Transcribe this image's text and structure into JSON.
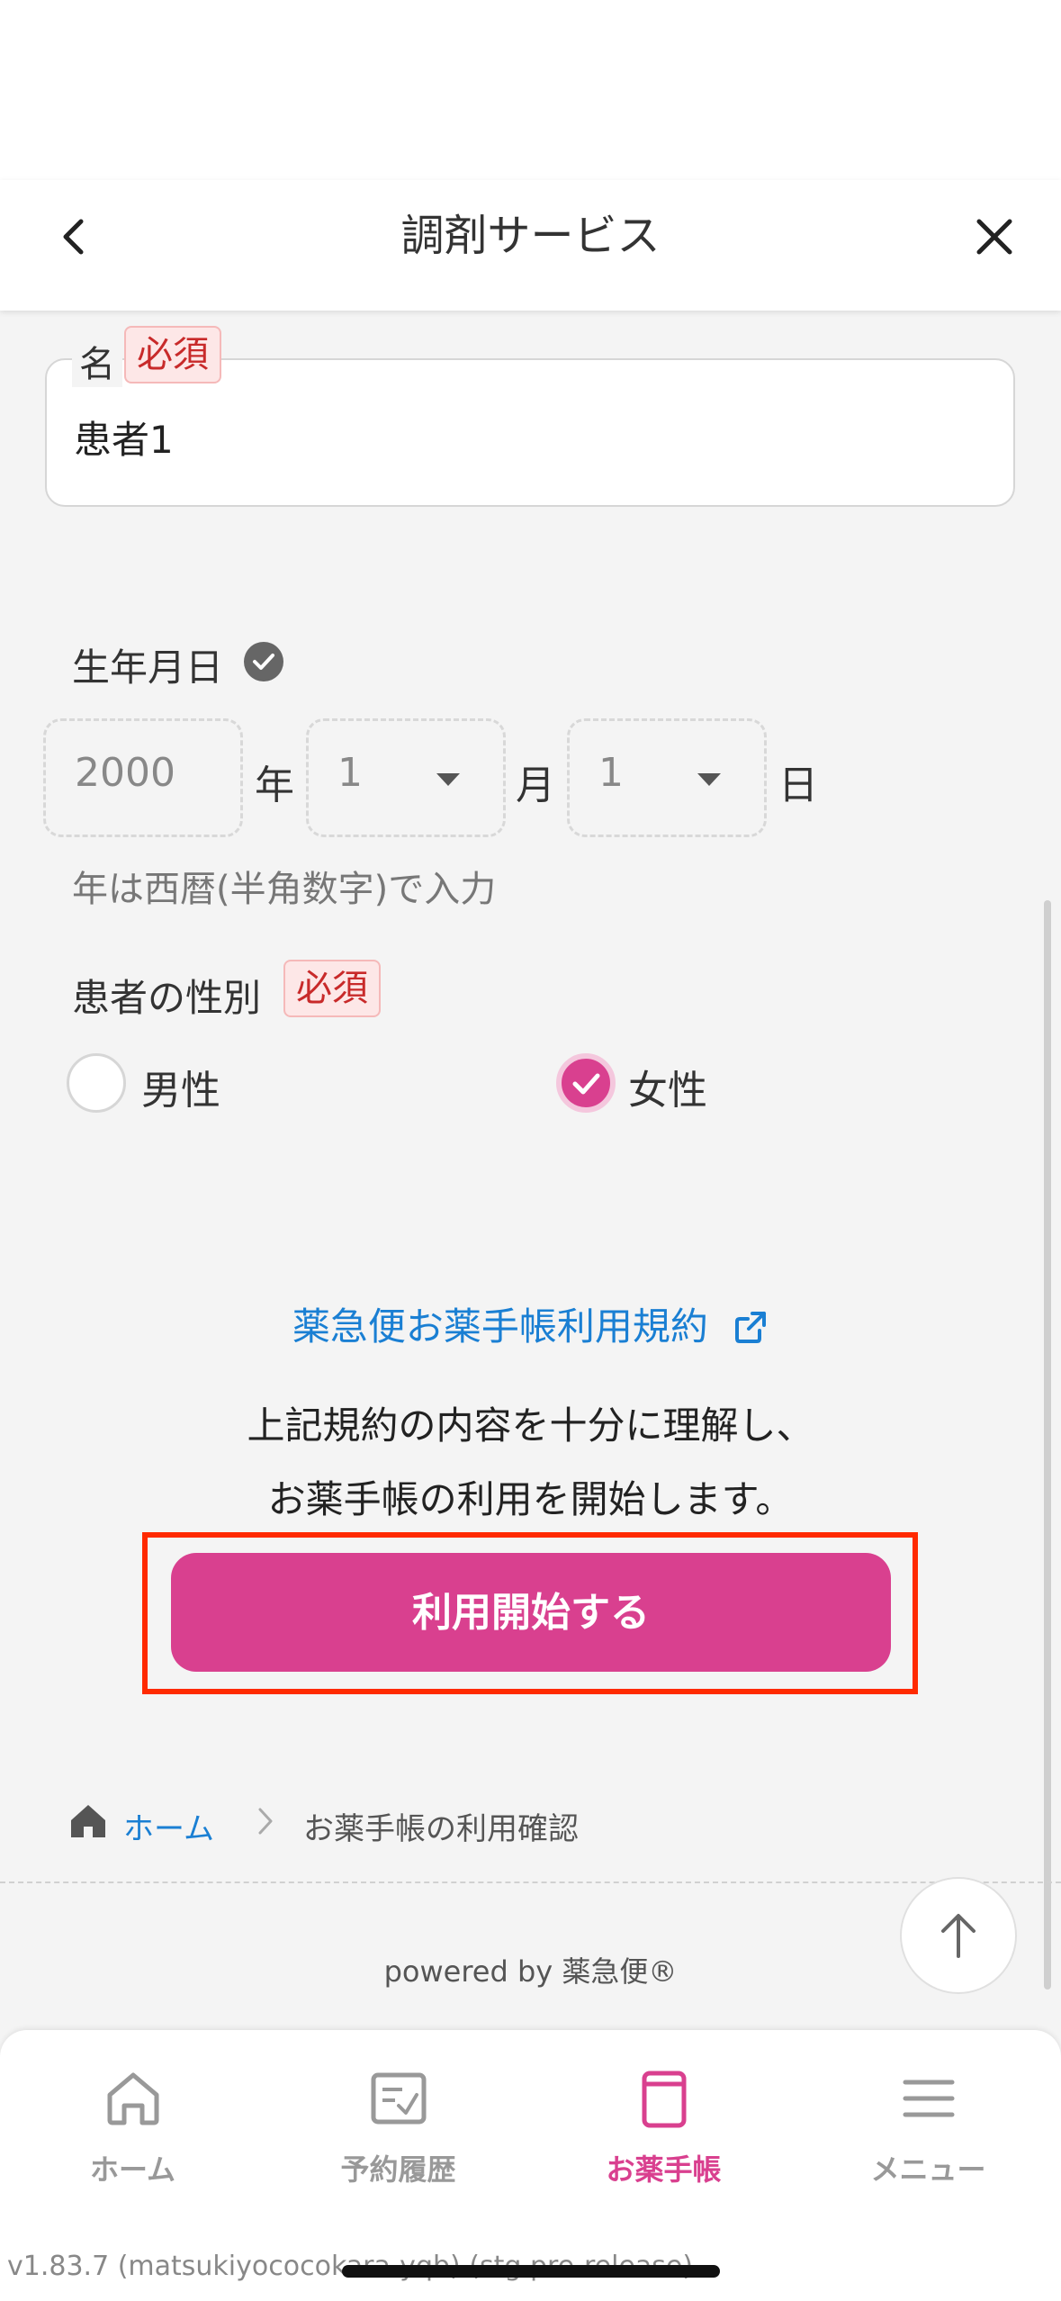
{
  "header": {
    "title": "調剤サービス",
    "back_icon": "chevron-left-icon",
    "close_icon": "close-icon"
  },
  "name_field": {
    "label": "名",
    "required": "必須",
    "value": "患者1"
  },
  "dob": {
    "label": "生年月日",
    "year_value": "2000",
    "year_unit": "年",
    "month_value": "1",
    "month_unit": "月",
    "day_value": "1",
    "day_unit": "日",
    "hint": "年は西暦(半角数字)で入力"
  },
  "gender": {
    "label": "患者の性別",
    "required": "必須",
    "options": [
      {
        "label": "男性",
        "selected": false
      },
      {
        "label": "女性",
        "selected": true
      }
    ]
  },
  "terms": {
    "link_text": "薬急便お薬手帳利用規約",
    "agree_line1": "上記規約の内容を十分に理解し、",
    "agree_line2": "お薬手帳の利用を開始します。",
    "start_button": "利用開始する"
  },
  "breadcrumb": {
    "home": "ホーム",
    "current": "お薬手帳の利用確認"
  },
  "footer": {
    "powered": "powered by 薬急便®"
  },
  "tabs": [
    {
      "label": "ホーム",
      "icon": "home-icon",
      "active": false
    },
    {
      "label": "予約履歴",
      "icon": "history-icon",
      "active": false
    },
    {
      "label": "お薬手帳",
      "icon": "notebook-icon",
      "active": true
    },
    {
      "label": "メニュー",
      "icon": "menu-icon",
      "active": false
    }
  ],
  "version": "v1.83.7 (matsukiyococokara-yqb) (stg.pre-release)",
  "colors": {
    "accent": "#d9408f",
    "link": "#1a7fd3",
    "required": "#c82a2a",
    "highlight": "#ff2a00"
  }
}
